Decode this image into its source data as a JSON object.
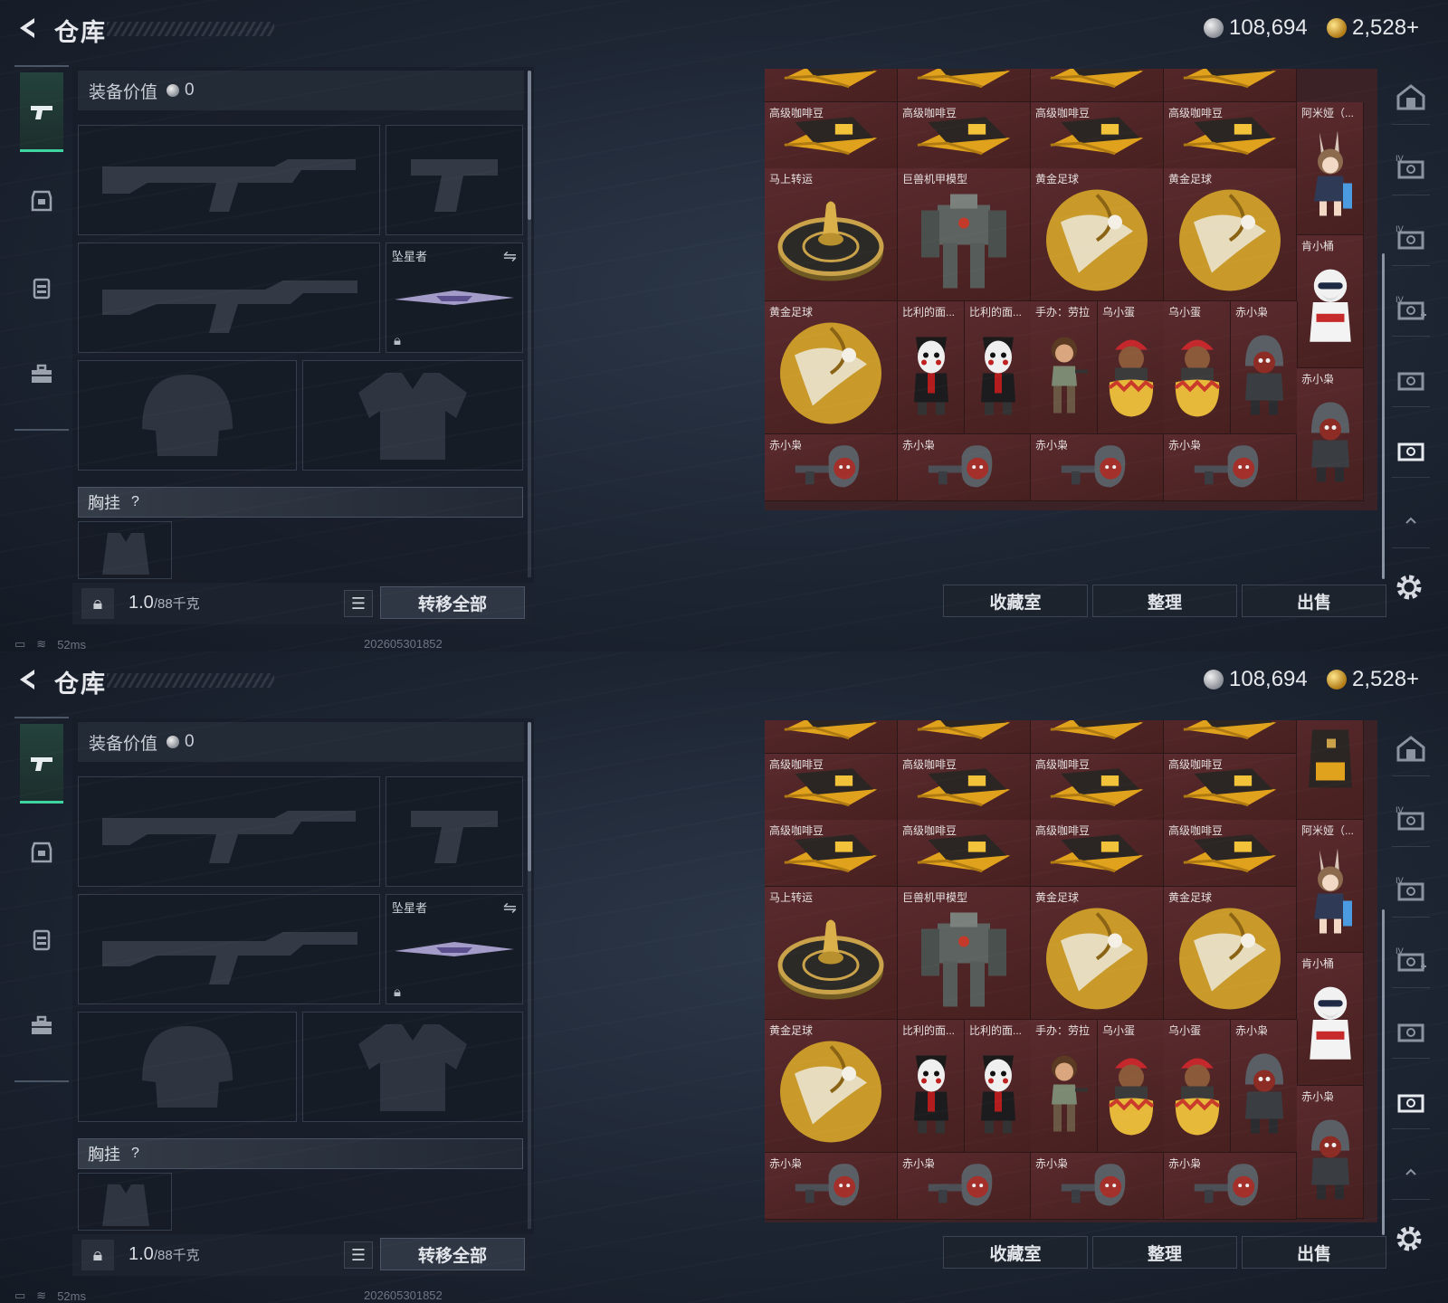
{
  "header": {
    "title": "仓库",
    "silver_amount": "108,694",
    "gold_amount": "2,528+"
  },
  "equipment": {
    "value_label": "装备价值",
    "value_amount": "0",
    "melee_label": "坠星者",
    "chest_label": "胸挂",
    "chest_help": "?",
    "weight_current": "1.0",
    "weight_max": "/88千克",
    "transfer_all_label": "转移全部"
  },
  "status": {
    "ping": "52ms",
    "build": "202605301852"
  },
  "buttons": {
    "collection": "收藏室",
    "sort": "整理",
    "sell": "出售"
  },
  "screens": [
    {
      "cells": [
        {
          "label": "",
          "art": "coffee"
        },
        {
          "label": "",
          "art": "coffee"
        },
        {
          "label": "",
          "art": "coffee"
        },
        {
          "label": "",
          "art": "coffee"
        },
        {
          "label": "高级咖啡豆",
          "art": "coffee"
        },
        {
          "label": "高级咖啡豆",
          "art": "coffee"
        },
        {
          "label": "高级咖啡豆",
          "art": "coffee"
        },
        {
          "label": "高级咖啡豆",
          "art": "coffee"
        },
        {
          "label": "阿米娅（...",
          "art": "figure-amiya"
        },
        {
          "label": "马上转运",
          "art": "wheel"
        },
        {
          "label": "巨兽机甲模型",
          "art": "mech"
        },
        {
          "label": "黄金足球",
          "art": "ball"
        },
        {
          "label": "黄金足球",
          "art": "ball"
        },
        {
          "label": "肯小桶",
          "art": "figure-kfc"
        },
        {
          "label": "黄金足球",
          "art": "ball"
        },
        {
          "label": "比利的面...",
          "art": "figure-billy"
        },
        {
          "label": "比利的面...",
          "art": "figure-billy"
        },
        {
          "label": "手办：劳拉",
          "art": "figure-lara"
        },
        {
          "label": "乌小蛋",
          "art": "figure-egg"
        },
        {
          "label": "乌小蛋",
          "art": "figure-egg"
        },
        {
          "label": "赤小枭",
          "art": "figure-hood"
        },
        {
          "label": "赤小枭",
          "art": "figure-hood"
        },
        {
          "label": "赤小枭",
          "art": "figure-gun"
        },
        {
          "label": "赤小枭",
          "art": "figure-gun"
        },
        {
          "label": "赤小枭",
          "art": "figure-gun"
        },
        {
          "label": "赤小枭",
          "art": "figure-gun"
        }
      ]
    },
    {
      "cells": [
        {
          "label": "",
          "art": "coffee"
        },
        {
          "label": "",
          "art": "coffee"
        },
        {
          "label": "",
          "art": "coffee"
        },
        {
          "label": "",
          "art": "coffee"
        },
        {
          "label": "",
          "art": "bag"
        },
        {
          "label": "高级咖啡豆",
          "art": "coffee"
        },
        {
          "label": "高级咖啡豆",
          "art": "coffee"
        },
        {
          "label": "高级咖啡豆",
          "art": "coffee"
        },
        {
          "label": "高级咖啡豆",
          "art": "coffee"
        },
        {
          "label": "高级咖啡豆",
          "art": "coffee"
        },
        {
          "label": "高级咖啡豆",
          "art": "coffee"
        },
        {
          "label": "高级咖啡豆",
          "art": "coffee"
        },
        {
          "label": "高级咖啡豆",
          "art": "coffee"
        },
        {
          "label": "阿米娅（...",
          "art": "figure-amiya"
        },
        {
          "label": "马上转运",
          "art": "wheel"
        },
        {
          "label": "巨兽机甲模型",
          "art": "mech"
        },
        {
          "label": "黄金足球",
          "art": "ball"
        },
        {
          "label": "黄金足球",
          "art": "ball"
        },
        {
          "label": "肯小桶",
          "art": "figure-kfc"
        },
        {
          "label": "黄金足球",
          "art": "ball"
        },
        {
          "label": "比利的面...",
          "art": "figure-billy"
        },
        {
          "label": "比利的面...",
          "art": "figure-billy"
        },
        {
          "label": "手办：劳拉",
          "art": "figure-lara"
        },
        {
          "label": "乌小蛋",
          "art": "figure-egg"
        },
        {
          "label": "乌小蛋",
          "art": "figure-egg"
        },
        {
          "label": "赤小枭",
          "art": "figure-hood"
        },
        {
          "label": "赤小枭",
          "art": "figure-hood"
        },
        {
          "label": "赤小枭",
          "art": "figure-gun"
        },
        {
          "label": "赤小枭",
          "art": "figure-gun"
        },
        {
          "label": "赤小枭",
          "art": "figure-gun"
        },
        {
          "label": "赤小枭",
          "art": "figure-gun"
        }
      ]
    }
  ]
}
